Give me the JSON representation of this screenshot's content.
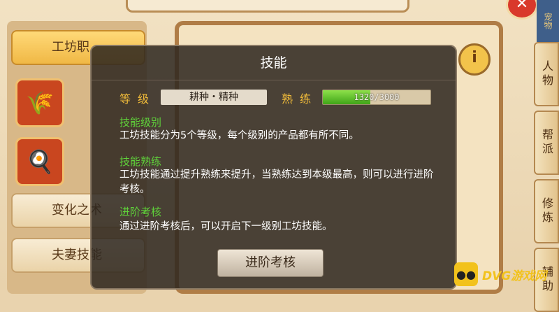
{
  "background": {
    "left_tabs": [
      {
        "label": "工坊职",
        "icon": "wheat-icon",
        "active": true
      },
      {
        "label": "",
        "icon": "wheat-icon"
      },
      {
        "label": "",
        "icon": "cooking-pot-icon"
      },
      {
        "label": "变化之术",
        "icon": ""
      },
      {
        "label": "夫妻技能",
        "icon": ""
      }
    ],
    "right_tabs": [
      "人物",
      "帮派",
      "修炼",
      "辅助"
    ],
    "corner_tag": "宠物",
    "close_label": "✕",
    "info_label": "i"
  },
  "modal": {
    "title": "技能",
    "level_label": "等级",
    "skill_name": "耕种・精种",
    "proficiency_label": "熟练",
    "proficiency": {
      "current": 1320,
      "max": 3000,
      "text": "1320/3000"
    },
    "sections": [
      {
        "heading": "技能级别",
        "body": "工坊技能分为5个等级，每个级别的产品都有所不同。"
      },
      {
        "heading": "技能熟练",
        "body": "工坊技能通过提升熟练来提升，当熟练达到本级最高，则可以进行进阶考核。"
      },
      {
        "heading": "进阶考核",
        "body": "通过进阶考核后，可以开启下一级别工坊技能。"
      }
    ],
    "action_button": "进阶考核"
  },
  "watermark": {
    "text": "DVG游戏网",
    "icon": "gamepad-icon"
  }
}
